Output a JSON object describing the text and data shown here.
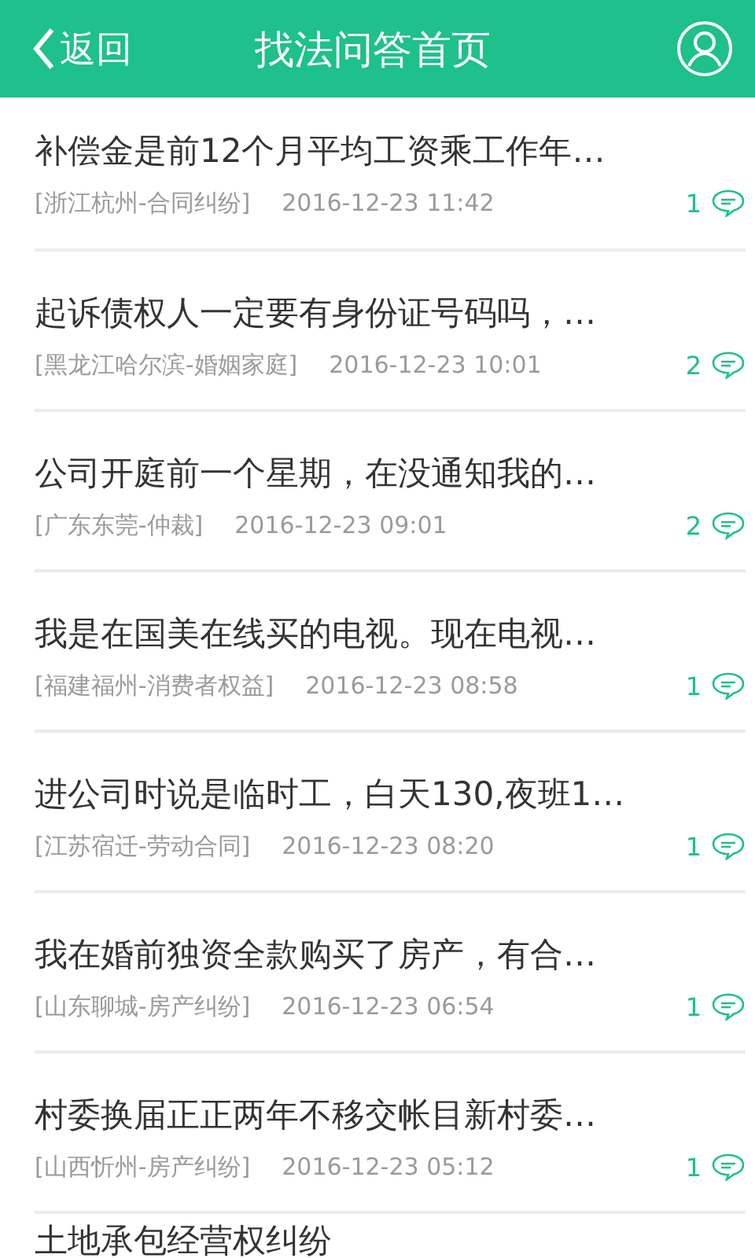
{
  "header": {
    "back_label": "返回",
    "title": "找法问答首页"
  },
  "questions": [
    {
      "title": "补偿金是前12个月平均工资乘工作年…",
      "category": "[浙江杭州-合同纠纷]",
      "time": "2016-12-23 11:42",
      "answers": "1"
    },
    {
      "title": "起诉债权人一定要有身份证号码吗，…",
      "category": "[黑龙江哈尔滨-婚姻家庭]",
      "time": "2016-12-23 10:01",
      "answers": "2"
    },
    {
      "title": "公司开庭前一个星期，在没通知我的…",
      "category": "[广东东莞-仲裁]",
      "time": "2016-12-23 09:01",
      "answers": "2"
    },
    {
      "title": "我是在国美在线买的电视。现在电视…",
      "category": "[福建福州-消费者权益]",
      "time": "2016-12-23 08:58",
      "answers": "1"
    },
    {
      "title": "进公司时说是临时工，白天130,夜班1…",
      "category": "[江苏宿迁-劳动合同]",
      "time": "2016-12-23 08:20",
      "answers": "1"
    },
    {
      "title": "我在婚前独资全款购买了房产，有合…",
      "category": "[山东聊城-房产纠纷]",
      "time": "2016-12-23 06:54",
      "answers": "1"
    },
    {
      "title": "村委换届正正两年不移交帐目新村委…",
      "category": "[山西忻州-房产纠纷]",
      "time": "2016-12-23 05:12",
      "answers": "1"
    },
    {
      "title": "土地承包经营权纠纷"
    }
  ]
}
